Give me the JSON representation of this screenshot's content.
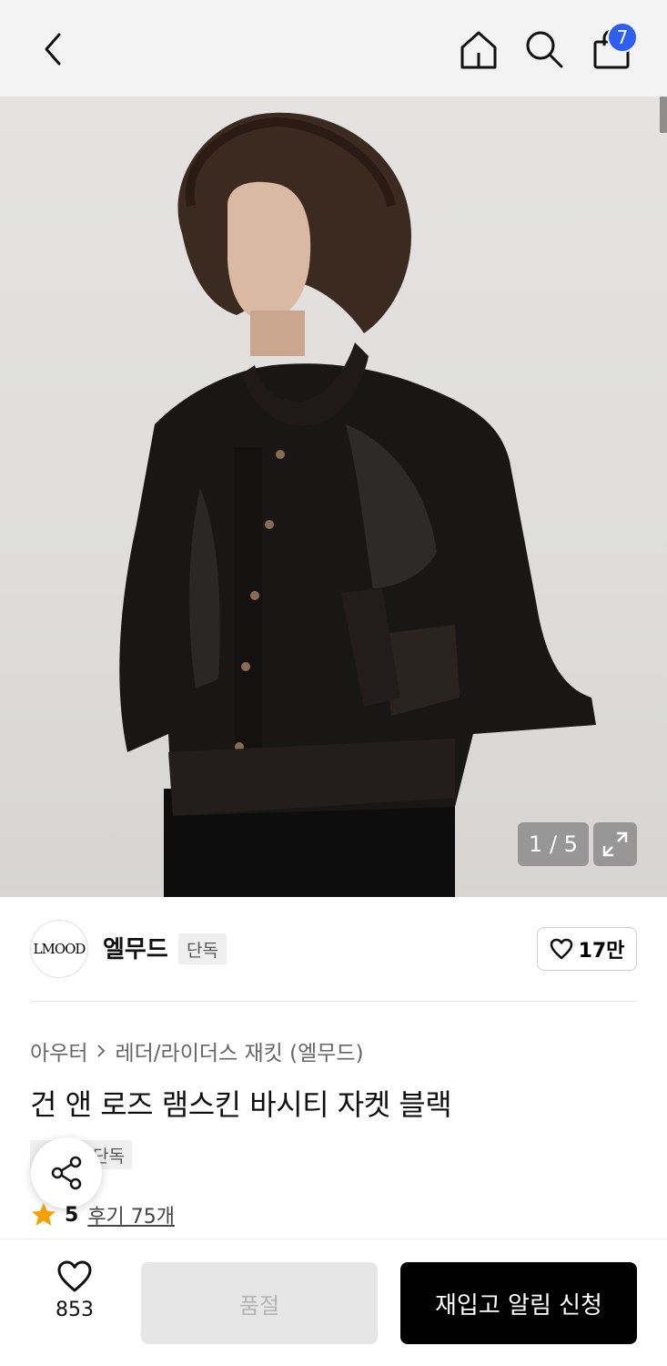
{
  "header": {
    "cart_count": "7"
  },
  "gallery": {
    "counter": "1 / 5"
  },
  "brand": {
    "logo_text": "LMOOD",
    "name": "엘무드",
    "badge": "단독",
    "likes": "17만"
  },
  "product": {
    "breadcrumb": [
      "아우터",
      "레더/라이더스 재킷 (엘무드)"
    ],
    "title": "건 앤 로즈 램스킨 바시티 자켓 블랙",
    "tag": "단독",
    "rating": "5",
    "reviews": "후기 75개"
  },
  "bottom_bar": {
    "wish_count": "853",
    "soldout_label": "품절",
    "restock_label": "재입고 알림 신청"
  },
  "colors": {
    "accent": "#2f5ff2",
    "star": "#f5a000",
    "primary_button": "#000000"
  }
}
